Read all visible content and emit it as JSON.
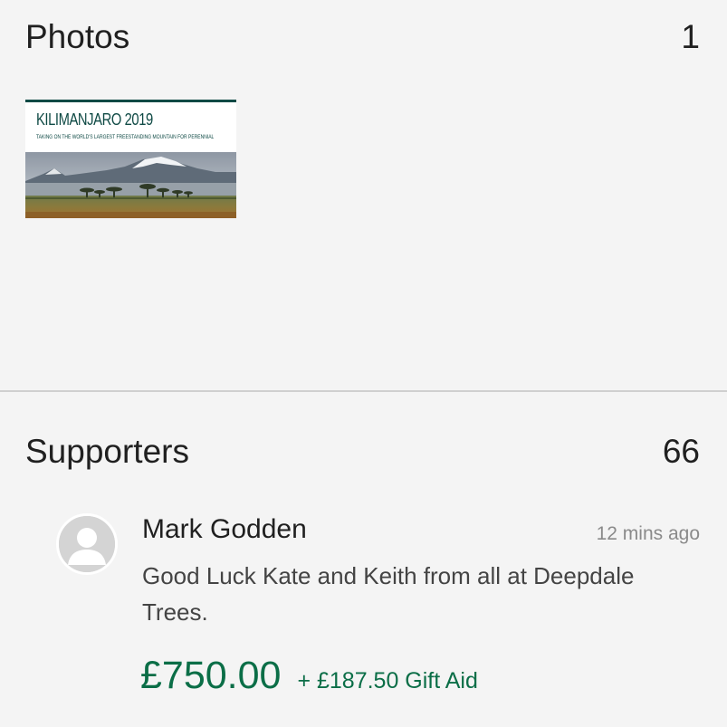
{
  "photos": {
    "title": "Photos",
    "count": "1",
    "items": [
      {
        "title": "KILIMANJARO 2019",
        "subtitle": "TAKING ON THE WORLD'S LARGEST FREESTANDING MOUNTAIN FOR PERENNIAL"
      }
    ]
  },
  "supporters": {
    "title": "Supporters",
    "count": "66",
    "items": [
      {
        "name": "Mark Godden",
        "time": "12 mins ago",
        "message": "Good Luck Kate and Keith from all at Deepdale Trees.",
        "amount": "£750.00",
        "gift_aid": "+ £187.50 Gift Aid",
        "avatar_icon": "user-placeholder-icon"
      }
    ]
  },
  "colors": {
    "accent_green": "#0b6e47",
    "thumb_border": "#0f4a45",
    "background": "#f4f4f4"
  }
}
